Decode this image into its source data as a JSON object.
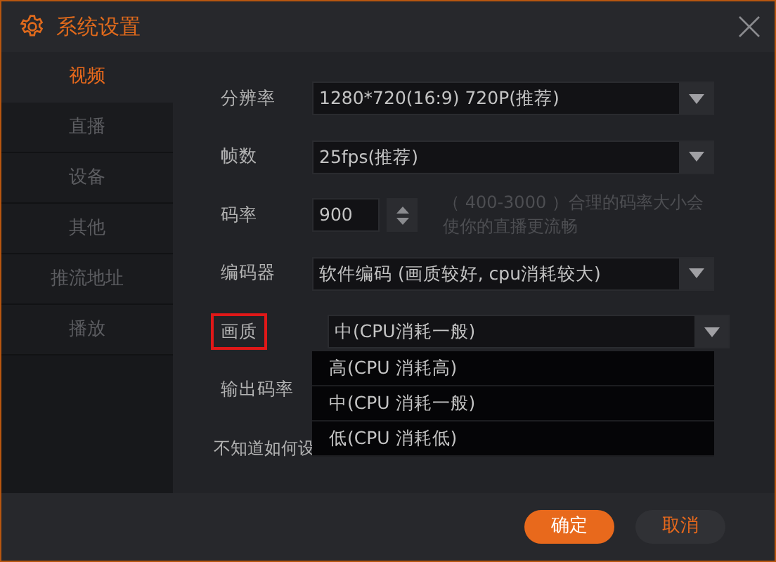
{
  "window": {
    "title": "系统设置"
  },
  "sidebar": {
    "items": [
      {
        "label": "视频",
        "selected": true
      },
      {
        "label": "直播",
        "selected": false
      },
      {
        "label": "设备",
        "selected": false
      },
      {
        "label": "其他",
        "selected": false
      },
      {
        "label": "推流地址",
        "selected": false
      },
      {
        "label": "播放",
        "selected": false
      }
    ]
  },
  "form": {
    "fields": [
      {
        "kind": "select",
        "label": "分辨率",
        "value": "1280*720(16:9) 720P(推荐)"
      },
      {
        "kind": "select",
        "label": "帧数",
        "value": "25fps(推荐)"
      },
      {
        "kind": "spin",
        "label": "码率",
        "value": "900",
        "hint": "（ 400-3000 ）合理的码率大小会使你的直播更流畅"
      },
      {
        "kind": "select",
        "label": "编码器",
        "value": "软件编码 (画质较好, cpu消耗较大)"
      },
      {
        "kind": "select",
        "label": "画质",
        "value": "中(CPU消耗一般)",
        "highlighted": true,
        "expanded": true,
        "options": [
          "高(CPU 消耗高)",
          "中(CPU 消耗一般)",
          "低(CPU 消耗低)"
        ]
      },
      {
        "kind": "plain",
        "label": "输出码率"
      },
      {
        "kind": "note",
        "label": "不知道如何设"
      }
    ]
  },
  "footer": {
    "buttons": [
      {
        "label": "确定",
        "kind": "primary"
      },
      {
        "label": "取消",
        "kind": "secondary"
      }
    ]
  }
}
